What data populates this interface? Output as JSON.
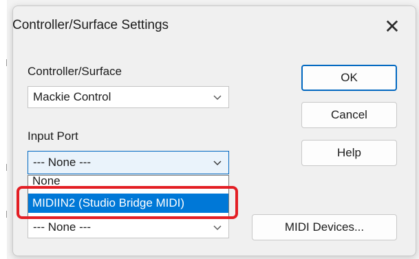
{
  "dialog": {
    "title": "Controller/Surface Settings",
    "close_glyph": "✕"
  },
  "controller_surface": {
    "label": "Controller/Surface",
    "value": "Mackie Control"
  },
  "input_port": {
    "label": "Input Port",
    "value": "--- None ---",
    "options": [
      "None",
      "MIDIIN2 (Studio Bridge MIDI)"
    ],
    "selected_option": "MIDIIN2 (Studio Bridge MIDI)"
  },
  "output_port": {
    "value": "--- None ---"
  },
  "buttons": {
    "ok": "OK",
    "cancel": "Cancel",
    "help": "Help",
    "midi_devices": "MIDI Devices..."
  },
  "colors": {
    "highlight": "#e31e24",
    "selection": "#0078d7",
    "focus": "#0067c0"
  },
  "icons": {
    "close": "close-icon",
    "chevron": "chevron-down-icon"
  }
}
